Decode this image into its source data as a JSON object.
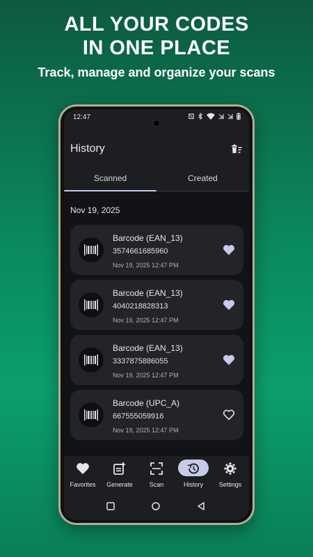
{
  "promo": {
    "title_line1": "ALL YOUR CODES",
    "title_line2": "IN ONE PLACE",
    "subtitle": "Track, manage and organize your scans"
  },
  "status_bar": {
    "time": "12:47",
    "icons": [
      "nfc-icon",
      "bluetooth-icon",
      "wifi-icon",
      "signal-icon",
      "signal-icon",
      "battery-icon"
    ]
  },
  "app_bar": {
    "title": "History",
    "action_icon": "delete-sweep-icon"
  },
  "tabs": [
    {
      "label": "Scanned",
      "selected": true
    },
    {
      "label": "Created",
      "selected": false
    }
  ],
  "history": {
    "date_header": "Nov 19, 2025",
    "items": [
      {
        "title": "Barcode (EAN_13)",
        "code": "3574661685960",
        "timestamp": "Nov 19, 2025 12:47 PM",
        "favorite": true
      },
      {
        "title": "Barcode (EAN_13)",
        "code": "4040218828313",
        "timestamp": "Nov 19, 2025 12:47 PM",
        "favorite": true
      },
      {
        "title": "Barcode (EAN_13)",
        "code": "3337875886055",
        "timestamp": "Nov 19, 2025 12:47 PM",
        "favorite": true
      },
      {
        "title": "Barcode (UPC_A)",
        "code": "667555059916",
        "timestamp": "Nov 19, 2025 12:47 PM",
        "favorite": false
      }
    ]
  },
  "bottom_nav": [
    {
      "label": "Favorites",
      "icon": "heart-icon",
      "selected": false
    },
    {
      "label": "Generate",
      "icon": "generate-icon",
      "selected": false
    },
    {
      "label": "Scan",
      "icon": "scan-icon",
      "selected": false
    },
    {
      "label": "History",
      "icon": "history-icon",
      "selected": true
    },
    {
      "label": "Settings",
      "icon": "gear-icon",
      "selected": false
    }
  ],
  "system_nav": [
    "recents-icon",
    "home-icon",
    "back-icon"
  ],
  "colors": {
    "background_gradient_top": "#0d5a41",
    "background_gradient_mid": "#0a8a5f",
    "accent": "#c6cbe8",
    "screen_bg": "#1d1e21",
    "card_bg": "#232428",
    "list_bg": "#121316"
  }
}
